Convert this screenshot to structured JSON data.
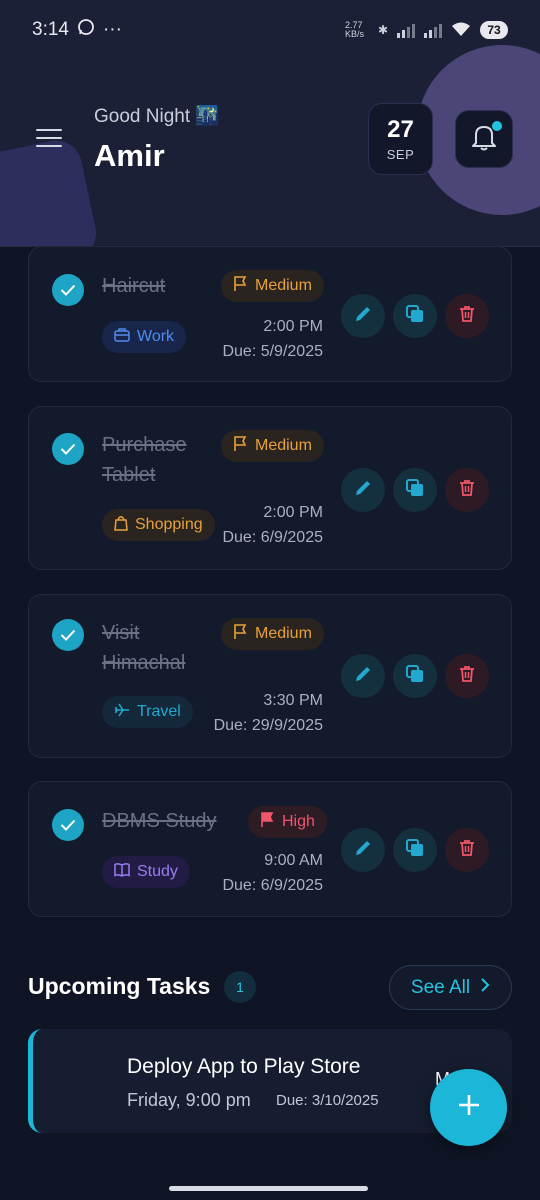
{
  "status_bar": {
    "time": "3:14",
    "net_speed": "2.77 KB/s",
    "battery": "73"
  },
  "header": {
    "greeting": "Good Night 🌃",
    "username": "Amir",
    "date_day": "27",
    "date_month": "SEP",
    "icons": [
      "menu-icon",
      "bell-icon"
    ]
  },
  "tasks": [
    {
      "title": "Haircut",
      "priority": "Medium",
      "category": "Work",
      "time": "2:00 PM",
      "due": "Due: 5/9/2025",
      "completed": true
    },
    {
      "title": "Purchase Tablet",
      "priority": "Medium",
      "category": "Shopping",
      "time": "2:00 PM",
      "due": "Due: 6/9/2025",
      "completed": true
    },
    {
      "title": "Visit Himachal",
      "priority": "Medium",
      "category": "Travel",
      "time": "3:30 PM",
      "due": "Due: 29/9/2025",
      "completed": true
    },
    {
      "title": "DBMS Study",
      "priority": "High",
      "category": "Study",
      "time": "9:00 AM",
      "due": "Due: 6/9/2025",
      "completed": true
    }
  ],
  "upcoming": {
    "title": "Upcoming Tasks",
    "count": "1",
    "see_all": "See All",
    "item": {
      "title": "Deploy App to Play Store",
      "time": "Friday, 9:00 pm",
      "due": "Due: 3/10/2025",
      "extra": "M"
    }
  },
  "colors": {
    "accent": "#1cb6d8",
    "background": "#0f1525",
    "medium": "#e8a13a",
    "high": "#f0566a"
  }
}
